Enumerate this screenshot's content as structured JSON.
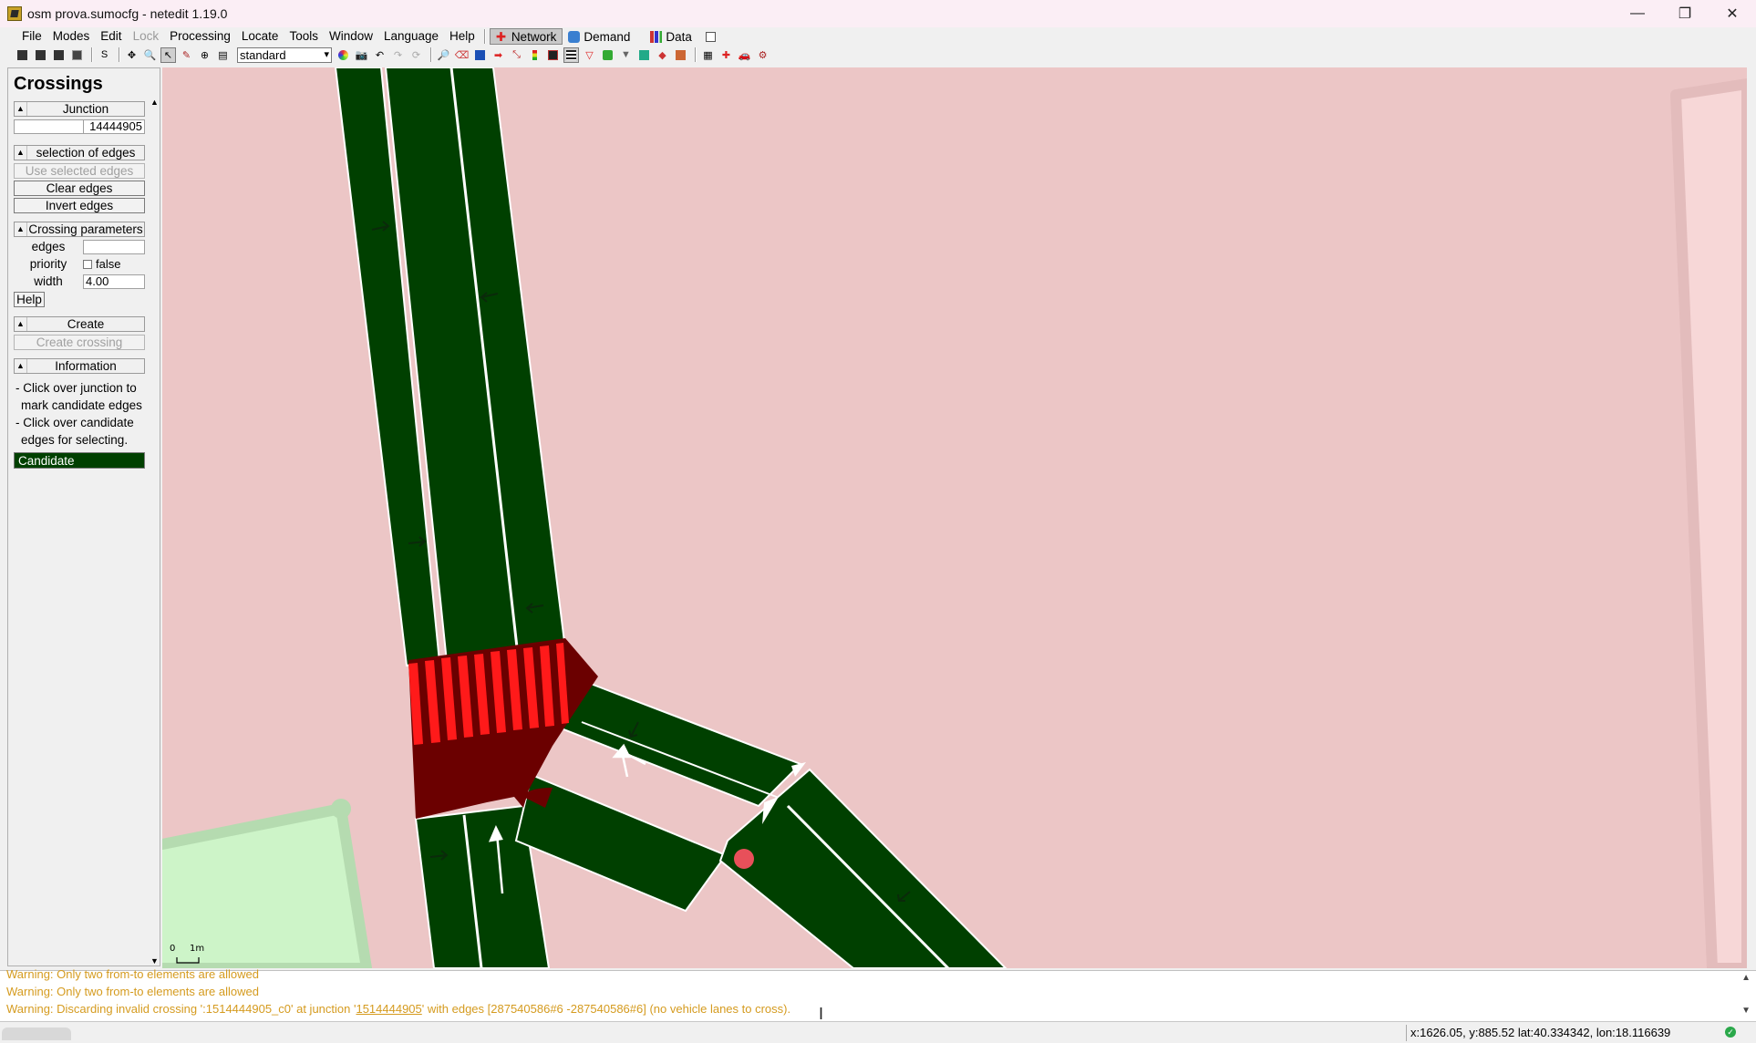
{
  "window": {
    "title": "osm prova.sumocfg - netedit 1.19.0",
    "minimize": "—",
    "restore": "❐",
    "close": "✕"
  },
  "menu": {
    "items": [
      "File",
      "Modes",
      "Edit",
      "Lock",
      "Processing",
      "Locate",
      "Tools",
      "Window",
      "Language",
      "Help"
    ],
    "supermodes": [
      "Network",
      "Demand",
      "Data"
    ]
  },
  "toolbar": {
    "scheme": "standard",
    "s_label": "S"
  },
  "frame": {
    "title": "Crossings",
    "junction": {
      "header": "Junction",
      "id_value": "14444905"
    },
    "selection": {
      "header": "selection of edges",
      "use_selected": "Use selected edges",
      "clear": "Clear edges",
      "invert": "Invert edges"
    },
    "params": {
      "header": "Crossing parameters",
      "edges_label": "edges",
      "edges_value": "",
      "priority_label": "priority",
      "priority_value": "false",
      "width_label": "width",
      "width_value": "4.00",
      "help": "Help"
    },
    "create": {
      "header": "Create",
      "button": "Create crossing"
    },
    "information": {
      "header": "Information",
      "line1": "- Click over junction to",
      "line2": "mark candidate edges",
      "line3": "- Click over candidate",
      "line4": "edges for selecting.",
      "legend_candidate": "Candidate"
    }
  },
  "canvas": {
    "scale_label_0": "0",
    "scale_label_1": "1m"
  },
  "messages": {
    "line1": "Warning: Only two from-to elements are allowed",
    "line2": "Warning: Only two from-to elements are allowed",
    "line3_prefix": "Warning: Discarding invalid crossing ':1514444905_c0' at junction '",
    "line3_link": "1514444905",
    "line3_suffix": "' with edges [287540586#6 -287540586#6] (no vehicle lanes to cross)."
  },
  "status": {
    "coords": "x:1626.05, y:885.52  lat:40.334342, lon:18.116639"
  }
}
